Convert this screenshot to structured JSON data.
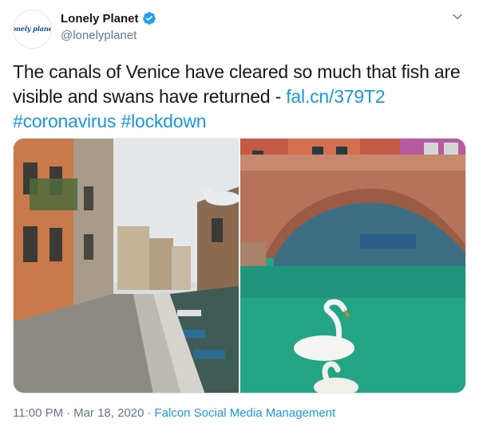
{
  "author": {
    "display_name": "Lonely Planet",
    "handle": "@lonelyplanet",
    "avatar_logo_text": "lonely planet",
    "verified": true
  },
  "tweet": {
    "text": "The canals of Venice have cleared so much that fish are visible and swans have returned - ",
    "link": "fal.cn/379T2",
    "hashtags": [
      "#coronavirus",
      "#lockdown"
    ]
  },
  "media": {
    "images": [
      {
        "subject": "Venice canal-side walkway with empty pavement and parked boats"
      },
      {
        "subject": "Brick arched bridge over clear green canal with two white swans"
      }
    ]
  },
  "meta": {
    "time": "11:00 PM",
    "date": "Mar 18, 2020",
    "separator": "·",
    "source": "Falcon Social Media Management"
  },
  "colors": {
    "link": "#1b95e0",
    "verified": "#1da1f2",
    "secondary_text": "#657786"
  }
}
